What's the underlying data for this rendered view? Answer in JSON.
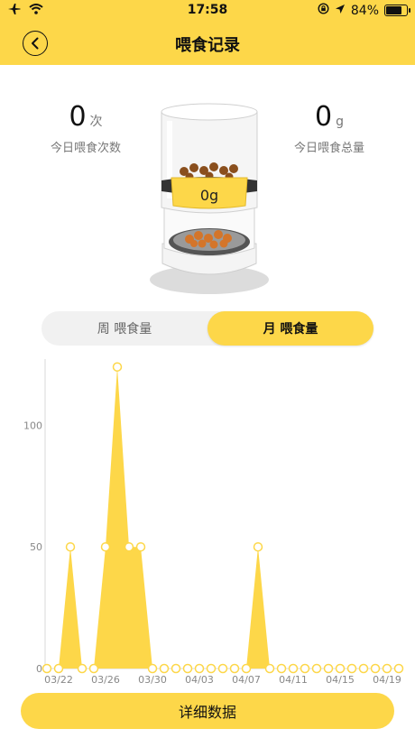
{
  "status": {
    "time": "17:58",
    "battery": "84%",
    "battery_level": 0.84
  },
  "nav": {
    "title": "喂食记录"
  },
  "stats": {
    "count_value": "0",
    "count_unit": "次",
    "count_label": "今日喂食次数",
    "amount_value": "0",
    "amount_unit": "g",
    "amount_label": "今日喂食总量"
  },
  "device": {
    "display": "0g"
  },
  "tabs": {
    "week": "周 喂食量",
    "month": "月 喂食量"
  },
  "buttons": {
    "detail": "详细数据"
  },
  "chart_data": {
    "type": "area",
    "title": "",
    "xlabel": "",
    "ylabel": "",
    "ylim": [
      0,
      125
    ],
    "yticks": [
      0,
      50,
      100
    ],
    "x": [
      "03/21",
      "03/22",
      "03/23",
      "03/24",
      "03/25",
      "03/26",
      "03/27",
      "03/28",
      "03/29",
      "03/30",
      "03/31",
      "04/01",
      "04/02",
      "04/03",
      "04/04",
      "04/05",
      "04/06",
      "04/07",
      "04/08",
      "04/09",
      "04/10",
      "04/11",
      "04/12",
      "04/13",
      "04/14",
      "04/15",
      "04/16",
      "04/17",
      "04/18",
      "04/19",
      "04/20"
    ],
    "x_tick_labels": [
      "03/22",
      "03/26",
      "03/30",
      "04/03",
      "04/07",
      "04/11",
      "04/15",
      "04/19"
    ],
    "values": [
      0,
      0,
      50,
      0,
      0,
      50,
      124,
      50,
      50,
      0,
      0,
      0,
      0,
      0,
      0,
      0,
      0,
      0,
      50,
      0,
      0,
      0,
      0,
      0,
      0,
      0,
      0,
      0,
      0,
      0,
      0
    ],
    "color": "#fdd749",
    "grid": false
  }
}
